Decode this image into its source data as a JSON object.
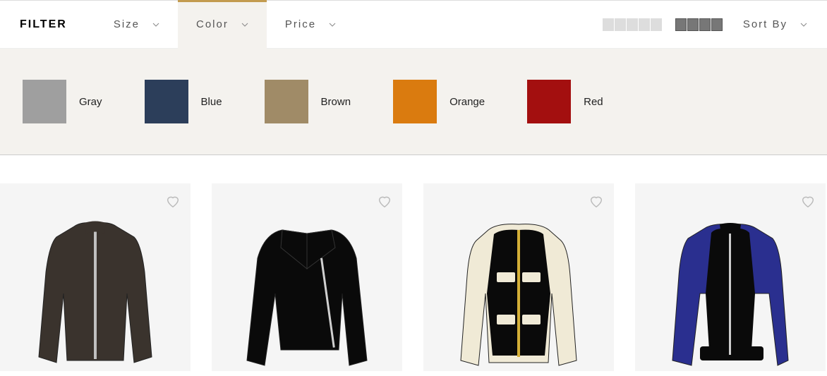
{
  "filter": {
    "label": "FILTER",
    "items": [
      {
        "label": "Size",
        "active": false
      },
      {
        "label": "Color",
        "active": true
      },
      {
        "label": "Price",
        "active": false
      }
    ],
    "sort_label": "Sort By"
  },
  "colors": [
    {
      "name": "Gray",
      "hex": "#9f9f9f"
    },
    {
      "name": "Blue",
      "hex": "#2c3e5a"
    },
    {
      "name": "Brown",
      "hex": "#a08b67"
    },
    {
      "name": "Orange",
      "hex": "#da7b0f"
    },
    {
      "name": "Red",
      "hex": "#a30f0f"
    }
  ],
  "products": [
    {
      "id": "jacket-1",
      "fill_main": "#3a332d",
      "fill_accent": "#c0c0c0",
      "trim": "#3a332d"
    },
    {
      "id": "jacket-2",
      "fill_main": "#0a0a0a",
      "fill_accent": "#d0d0d0",
      "trim": "#0a0a0a"
    },
    {
      "id": "jacket-3",
      "fill_main": "#0a0a0a",
      "fill_accent": "#f0ead6",
      "trim": "#f0ead6"
    },
    {
      "id": "jacket-4",
      "fill_main": "#0a0a0a",
      "fill_accent": "#2a2f8f",
      "trim": "#0a0a0a"
    }
  ]
}
